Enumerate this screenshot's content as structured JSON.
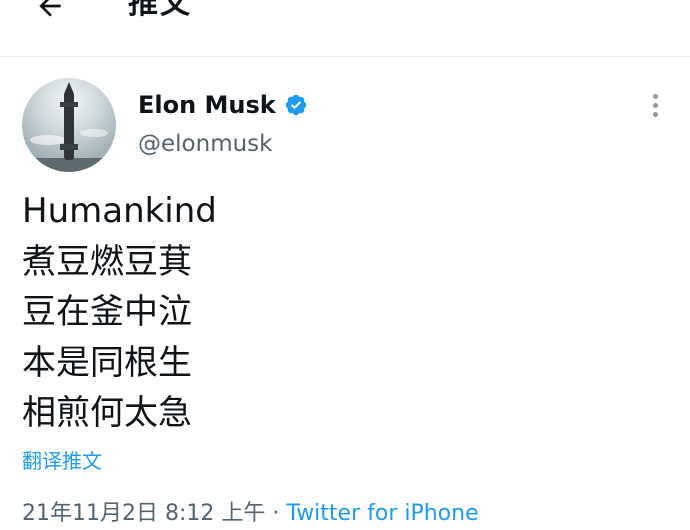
{
  "header": {
    "title": "推文",
    "back_icon": "arrow-left-icon"
  },
  "author": {
    "display_name": "Elon Musk",
    "handle": "@elonmusk",
    "verified_icon": "verified-badge-icon",
    "more_icon": "more-vertical-icon"
  },
  "tweet": {
    "lines": [
      "Humankind",
      "煮豆燃豆萁",
      "豆在釜中泣",
      "本是同根生",
      "相煎何太急"
    ],
    "translate_label": "翻译推文",
    "timestamp": "21年11月2日 8:12 上午",
    "separator": "·",
    "source": "Twitter for iPhone"
  },
  "colors": {
    "accent": "#1d9bf0",
    "text": "#0f1419",
    "secondary": "#536471",
    "divider": "#e6ecf0"
  }
}
